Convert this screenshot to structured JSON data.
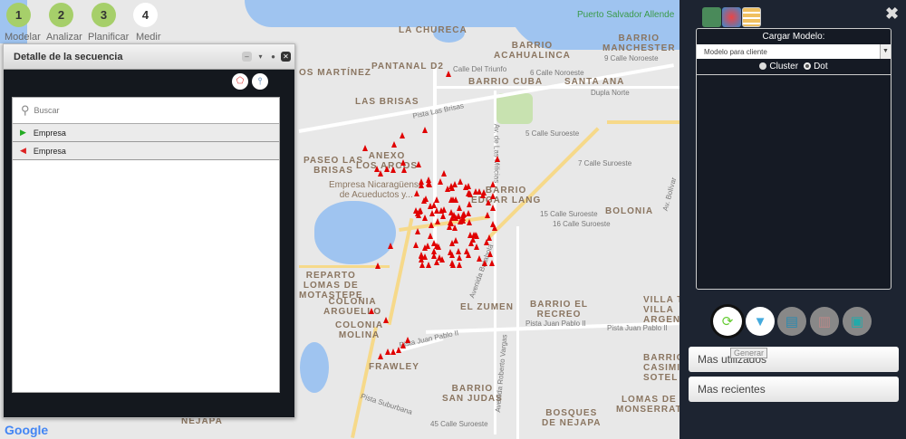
{
  "steps": [
    {
      "num": "1",
      "label": "Modelar"
    },
    {
      "num": "2",
      "label": "Analizar"
    },
    {
      "num": "3",
      "label": "Planificar"
    },
    {
      "num": "4",
      "label": "Medir"
    }
  ],
  "dialog": {
    "title": "Detalle de la secuencia",
    "search_placeholder": "Buscar",
    "items": [
      {
        "label": "Empresa",
        "icon": "green-flag-icon"
      },
      {
        "label": "Empresa",
        "icon": "red-flag-icon"
      }
    ]
  },
  "map": {
    "labels": [
      "LA CHURECA",
      "BARRIO\nACAHUALINCA",
      "BARRIO\nMANCHESTER",
      "PANTANAL D2",
      "OS MARTÍNEZ",
      "BARRIO CUBA",
      "SANTA ANA",
      "LAS BRISAS",
      "PASEO LAS\nBRISAS",
      "ANEXO\nLOS ARCOS",
      "BARRIO\nEDGAR LANG",
      "BOLONIA",
      "REPARTO\nLOMAS DE\nMOTASTEPE",
      "COLONIA\nARGUELLO",
      "COLONIA\nMOLINA",
      "EL ZUMEN",
      "BARRIO EL\nRECREO",
      "VILLA TI\nVILLA\nARGENT",
      "FRAWLEY",
      "BARRIO\nSAN JUDAS",
      "BARRIO\nCASIMI\nSOTEL",
      "LOMAS DE\nMONSERRAT",
      "BOSQUES\nDE NEJAPA",
      "NEJAPA"
    ],
    "streets": [
      "Calle Del Triunfo",
      "6 Calle Noroeste",
      "9 Calle Noroeste",
      "Dupla Norte",
      "Pista Las Brisas",
      "5 Calle Suroeste",
      "7 Calle Suroeste",
      "15 Calle Suroeste",
      "16 Calle Suroeste",
      "Pista Juan Pablo II",
      "Pista Juan Pablo II",
      "Pista Juan Pablo II",
      "Pista Suburbana",
      "45 Calle Suroeste",
      "Avenida Roberto Vargas",
      "Avenida Batahola",
      "Av. de Las Milicias",
      "Av. Bolívar"
    ],
    "poi": "Empresa Nicaragüense\nde Acueductos y...",
    "port": "Puerto Salvador Allende",
    "google": "Google",
    "marker_color": "#e00000"
  },
  "panel": {
    "tabs": [
      "route-map-icon",
      "heatmap-globe-icon",
      "database-icon"
    ],
    "header": "Cargar Modelo:",
    "model_select": "Modelo para cliente",
    "radio_options": [
      {
        "label": "Cluster",
        "checked": false
      },
      {
        "label": "Dot",
        "checked": true
      }
    ],
    "actions": [
      "refresh-icon",
      "filter-icon",
      "print-icon",
      "report-icon",
      "save-icon"
    ],
    "tooltip": "Generar",
    "buttons": [
      "Mas utilizados",
      "Mas recientes"
    ]
  }
}
